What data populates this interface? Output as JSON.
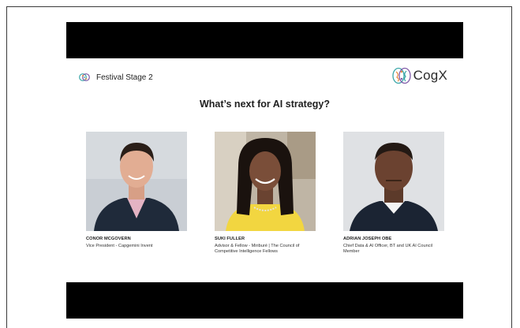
{
  "header": {
    "stage_label": "Festival Stage 2",
    "brand": "CogX"
  },
  "slide": {
    "title": "What’s next for AI strategy?"
  },
  "speakers": [
    {
      "name": "CONOR MCGOVERN",
      "role": "Vice President - Capgemini Invent"
    },
    {
      "name": "SUKI FULLER",
      "role": "Advisor & Fellow - Miriburé | The Council of Competitive Intelligence Fellows"
    },
    {
      "name": "ADRIAN JOSEPH OBE",
      "role": "Chief Data & AI Officer, BT and UK AI Council Member"
    }
  ],
  "colors": {
    "letterbox": "#000000",
    "brand_teal": "#3aa6a8",
    "brand_orange": "#e98b3f",
    "brand_purple": "#7f5aa8"
  }
}
